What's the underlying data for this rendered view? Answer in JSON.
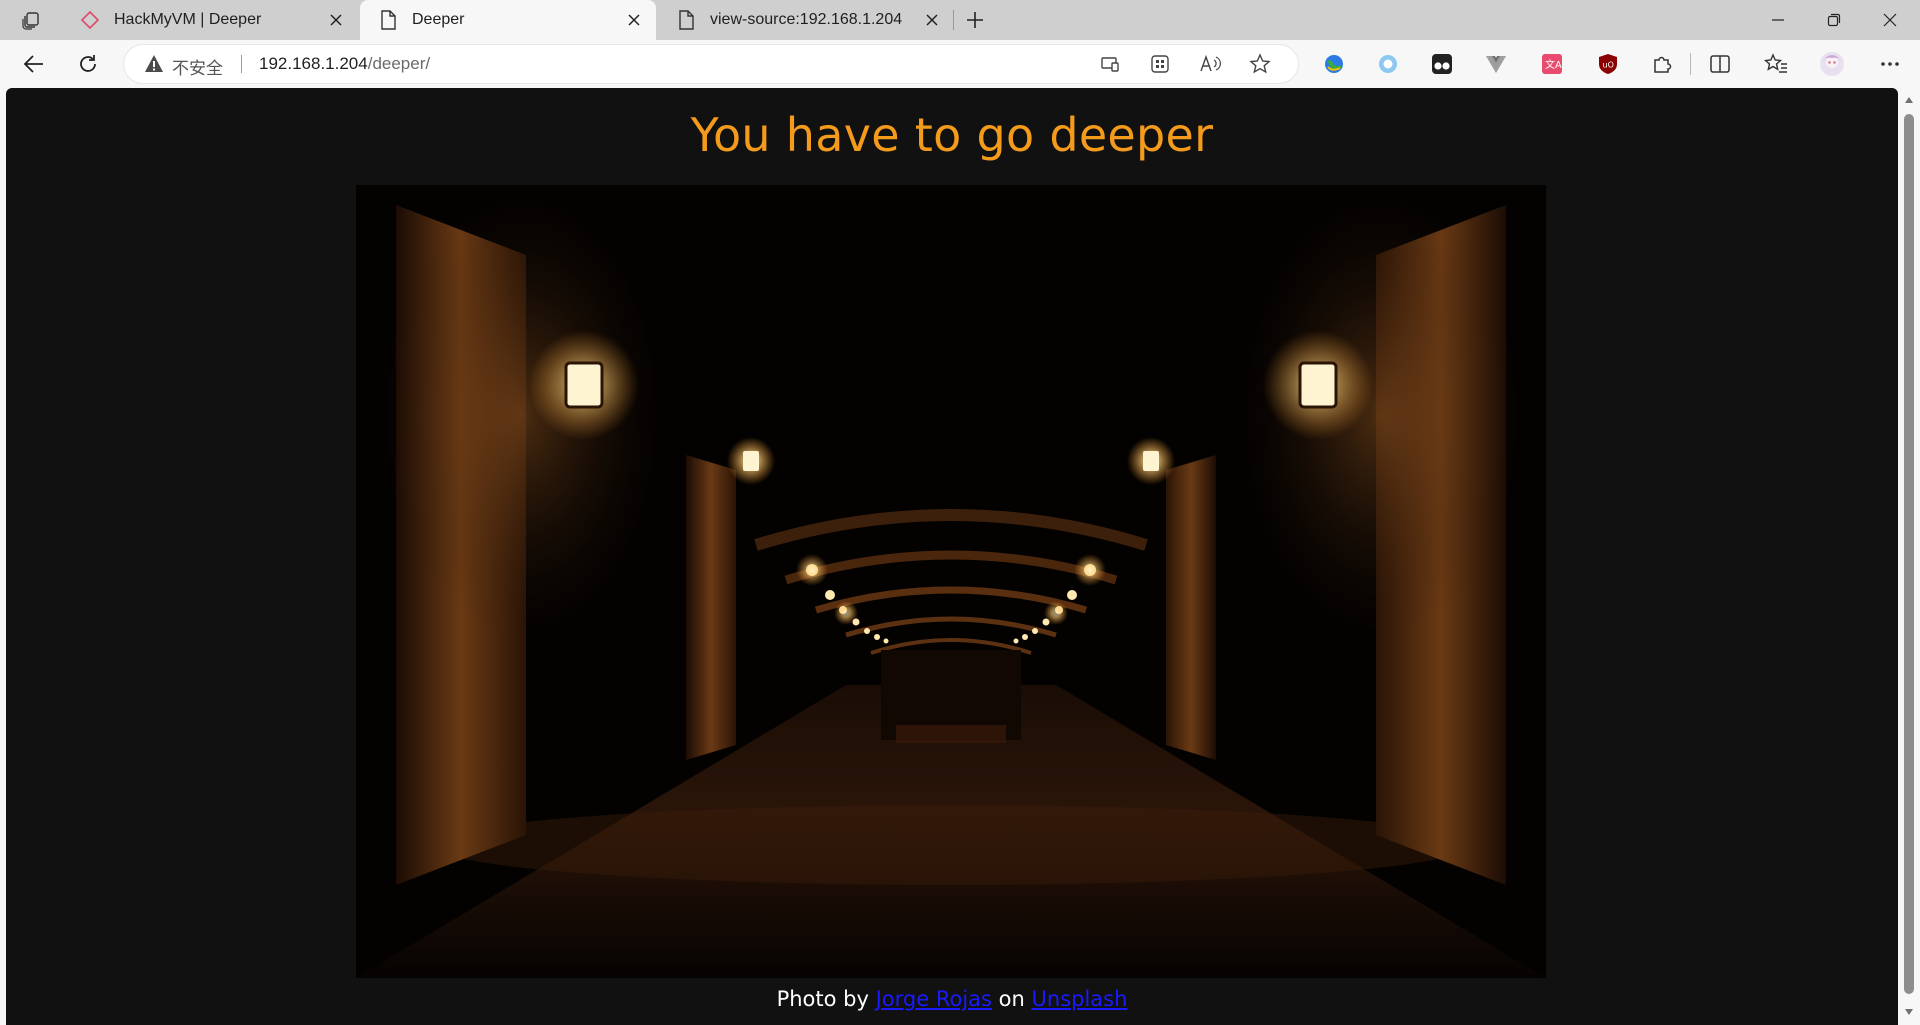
{
  "browser": {
    "tabs": [
      {
        "title": "HackMyVM | Deeper",
        "icon": "hackmyvm-icon",
        "active": false
      },
      {
        "title": "Deeper",
        "icon": "page-icon",
        "active": true
      },
      {
        "title": "view-source:192.168.1.204",
        "icon": "page-icon",
        "active": false
      }
    ],
    "address": {
      "security_label": "不安全",
      "host": "192.168.1.204",
      "path": "/deeper/"
    },
    "extensions": [
      "globe-extension-icon",
      "circle-extension-icon",
      "tampermonkey-icon",
      "vue-devtools-icon",
      "translate-extension-icon",
      "ublock-icon",
      "extensions-puzzle-icon"
    ],
    "accent_color": "#f49b1c"
  },
  "page": {
    "heading": "You have to go deeper",
    "caption": {
      "prefix": "Photo by",
      "author_link": "Jorge Rojas",
      "middle": "on",
      "site_link": "Unsplash"
    }
  }
}
